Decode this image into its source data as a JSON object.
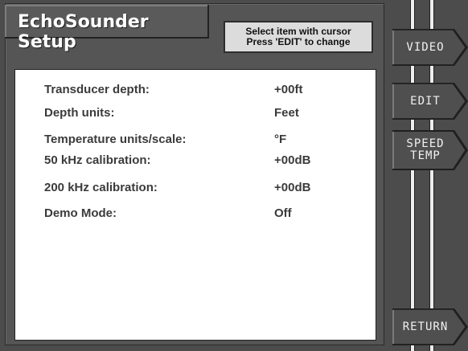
{
  "header": {
    "title": "EchoSounder Setup",
    "hint_line1": "Select item with cursor",
    "hint_line2": "Press 'EDIT' to change"
  },
  "settings": {
    "rows": [
      {
        "label": "Transducer depth:",
        "value": "+00ft"
      },
      {
        "label": "Depth units:",
        "value": "Feet"
      },
      {
        "label": "Temperature units/scale:",
        "value": "°F"
      },
      {
        "label": "50 kHz calibration:",
        "value": "+00dB"
      },
      {
        "label": "200 kHz calibration:",
        "value": "+00dB"
      },
      {
        "label": "Demo Mode:",
        "value": "Off"
      }
    ]
  },
  "softkeys": {
    "video": "VIDEO",
    "edit": "EDIT",
    "speed_temp_line1": "SPEED",
    "speed_temp_line2": "TEMP",
    "return": "RETURN"
  }
}
